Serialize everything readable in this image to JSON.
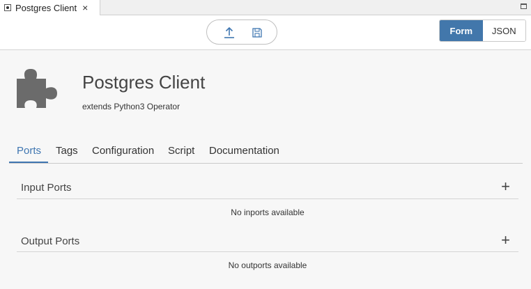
{
  "editor_tab": {
    "title": "Postgres Client",
    "close_icon": "×",
    "file_icon": "operator-file-icon"
  },
  "toolbar": {
    "upload_icon": "upload-icon",
    "save_icon": "save-icon"
  },
  "view_toggle": {
    "form_label": "Form",
    "json_label": "JSON",
    "active": "Form",
    "active_color": "#4277ab"
  },
  "operator": {
    "icon": "puzzle-piece-icon",
    "title": "Postgres Client",
    "subtitle": "extends Python3 Operator"
  },
  "tabs": [
    {
      "label": "Ports",
      "active": true
    },
    {
      "label": "Tags",
      "active": false
    },
    {
      "label": "Configuration",
      "active": false
    },
    {
      "label": "Script",
      "active": false
    },
    {
      "label": "Documentation",
      "active": false
    }
  ],
  "input_ports": {
    "title": "Input Ports",
    "add_symbol": "+",
    "empty_text": "No inports available"
  },
  "output_ports": {
    "title": "Output Ports",
    "add_symbol": "+",
    "empty_text": "No outports available"
  },
  "colors": {
    "accent": "#3f76b1",
    "background": "#f7f7f7"
  }
}
